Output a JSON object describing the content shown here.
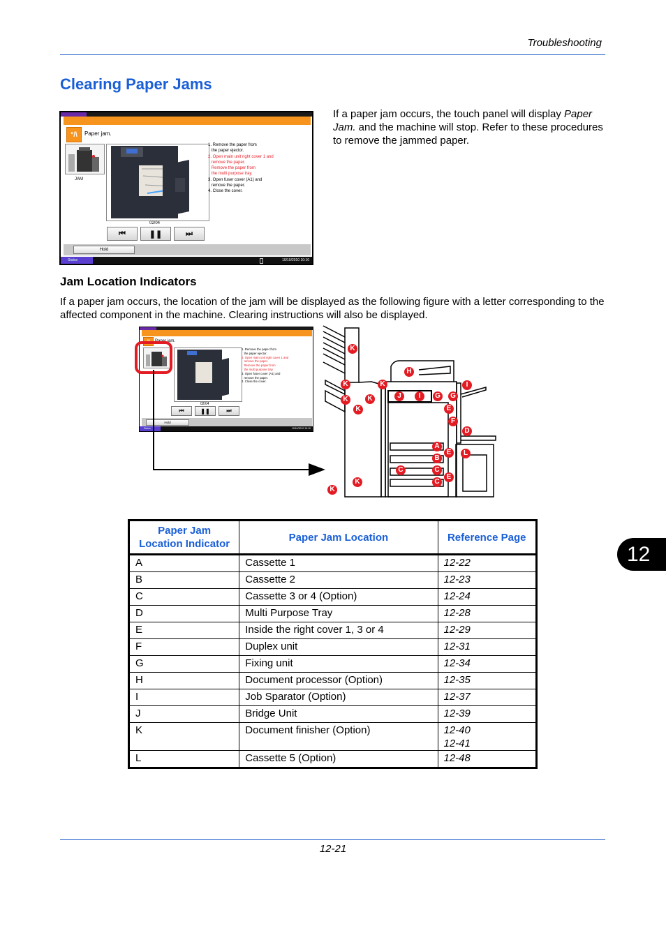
{
  "header": {
    "section": "Troubleshooting"
  },
  "page_title": "Clearing Paper Jams",
  "intro": {
    "before": "If a paper jam occurs, the touch panel will display ",
    "italic": "Paper Jam.",
    "after": " and the machine will stop. Refer to these procedures to remove the jammed paper."
  },
  "panel": {
    "message": "Paper jam.",
    "thumb_label": "JAM",
    "steps": [
      {
        "text": "1. Remove the paper from",
        "red": false
      },
      {
        "text": "the paper ejector.",
        "red": false,
        "indent": true
      },
      {
        "text": "2. Open main unit right cover 1 and",
        "red": true
      },
      {
        "text": "remove the paper.",
        "red": true,
        "indent": true
      },
      {
        "text": "Remove the paper from",
        "red": true,
        "indent": true
      },
      {
        "text": "the multi purpose tray.",
        "red": true,
        "indent": true
      },
      {
        "text": "3. Open fuser cover (A1) and",
        "red": false
      },
      {
        "text": "remove the paper.",
        "red": false,
        "indent": true
      },
      {
        "text": "4. Close the cover.",
        "red": false
      }
    ],
    "page_counter": "02/04",
    "buttons": {
      "prev": "first-page-icon",
      "pause": "pause-icon",
      "next": "last-page-icon",
      "hold": "Hold"
    },
    "status_label": "Status",
    "datetime": "10/10/2010  10:10"
  },
  "section2": {
    "heading": "Jam Location Indicators",
    "text": "If a paper jam occurs, the location of the jam will be displayed as the following figure with a letter corresponding to the affected component in the machine. Clearing instructions will also be displayed."
  },
  "diagram_markers": [
    "K",
    "K",
    "K",
    "K",
    "K",
    "K",
    "K",
    "K",
    "H",
    "J",
    "I",
    "G",
    "G",
    "I",
    "E",
    "F",
    "D",
    "A",
    "E",
    "B",
    "L",
    "C",
    "C",
    "E",
    "C"
  ],
  "chapter_tab": "12",
  "table": {
    "headers": [
      "Paper Jam Location Indicator",
      "Paper Jam Location",
      "Reference Page"
    ],
    "header_lines": [
      [
        "Paper Jam",
        "Location Indicator"
      ],
      [
        "Paper Jam Location"
      ],
      [
        "Reference Page"
      ]
    ],
    "rows": [
      {
        "indicator": "A",
        "location": "Cassette 1",
        "ref": [
          "12-22"
        ]
      },
      {
        "indicator": "B",
        "location": "Cassette 2",
        "ref": [
          "12-23"
        ]
      },
      {
        "indicator": "C",
        "location": "Cassette 3 or 4 (Option)",
        "ref": [
          "12-24"
        ]
      },
      {
        "indicator": "D",
        "location": "Multi Purpose Tray",
        "ref": [
          "12-28"
        ]
      },
      {
        "indicator": "E",
        "location": "Inside the right cover 1, 3 or 4",
        "ref": [
          "12-29"
        ]
      },
      {
        "indicator": "F",
        "location": "Duplex unit",
        "ref": [
          "12-31"
        ]
      },
      {
        "indicator": "G",
        "location": "Fixing unit",
        "ref": [
          "12-34"
        ]
      },
      {
        "indicator": "H",
        "location": "Document processor (Option)",
        "ref": [
          "12-35"
        ]
      },
      {
        "indicator": "I",
        "location": "Job Sparator (Option)",
        "ref": [
          "12-37"
        ]
      },
      {
        "indicator": "J",
        "location": "Bridge Unit",
        "ref": [
          "12-39"
        ]
      },
      {
        "indicator": "K",
        "location": "Document finisher (Option)",
        "ref": [
          "12-40",
          "12-41"
        ]
      },
      {
        "indicator": "L",
        "location": "Cassette 5 (Option)",
        "ref": [
          "12-48"
        ]
      }
    ]
  },
  "footer": {
    "page_number": "12-21"
  },
  "colors": {
    "accent_blue": "#1a5fd6",
    "panel_orange": "#f7941d",
    "marker_red": "#e31b23",
    "status_purple": "#5a3fd0"
  }
}
